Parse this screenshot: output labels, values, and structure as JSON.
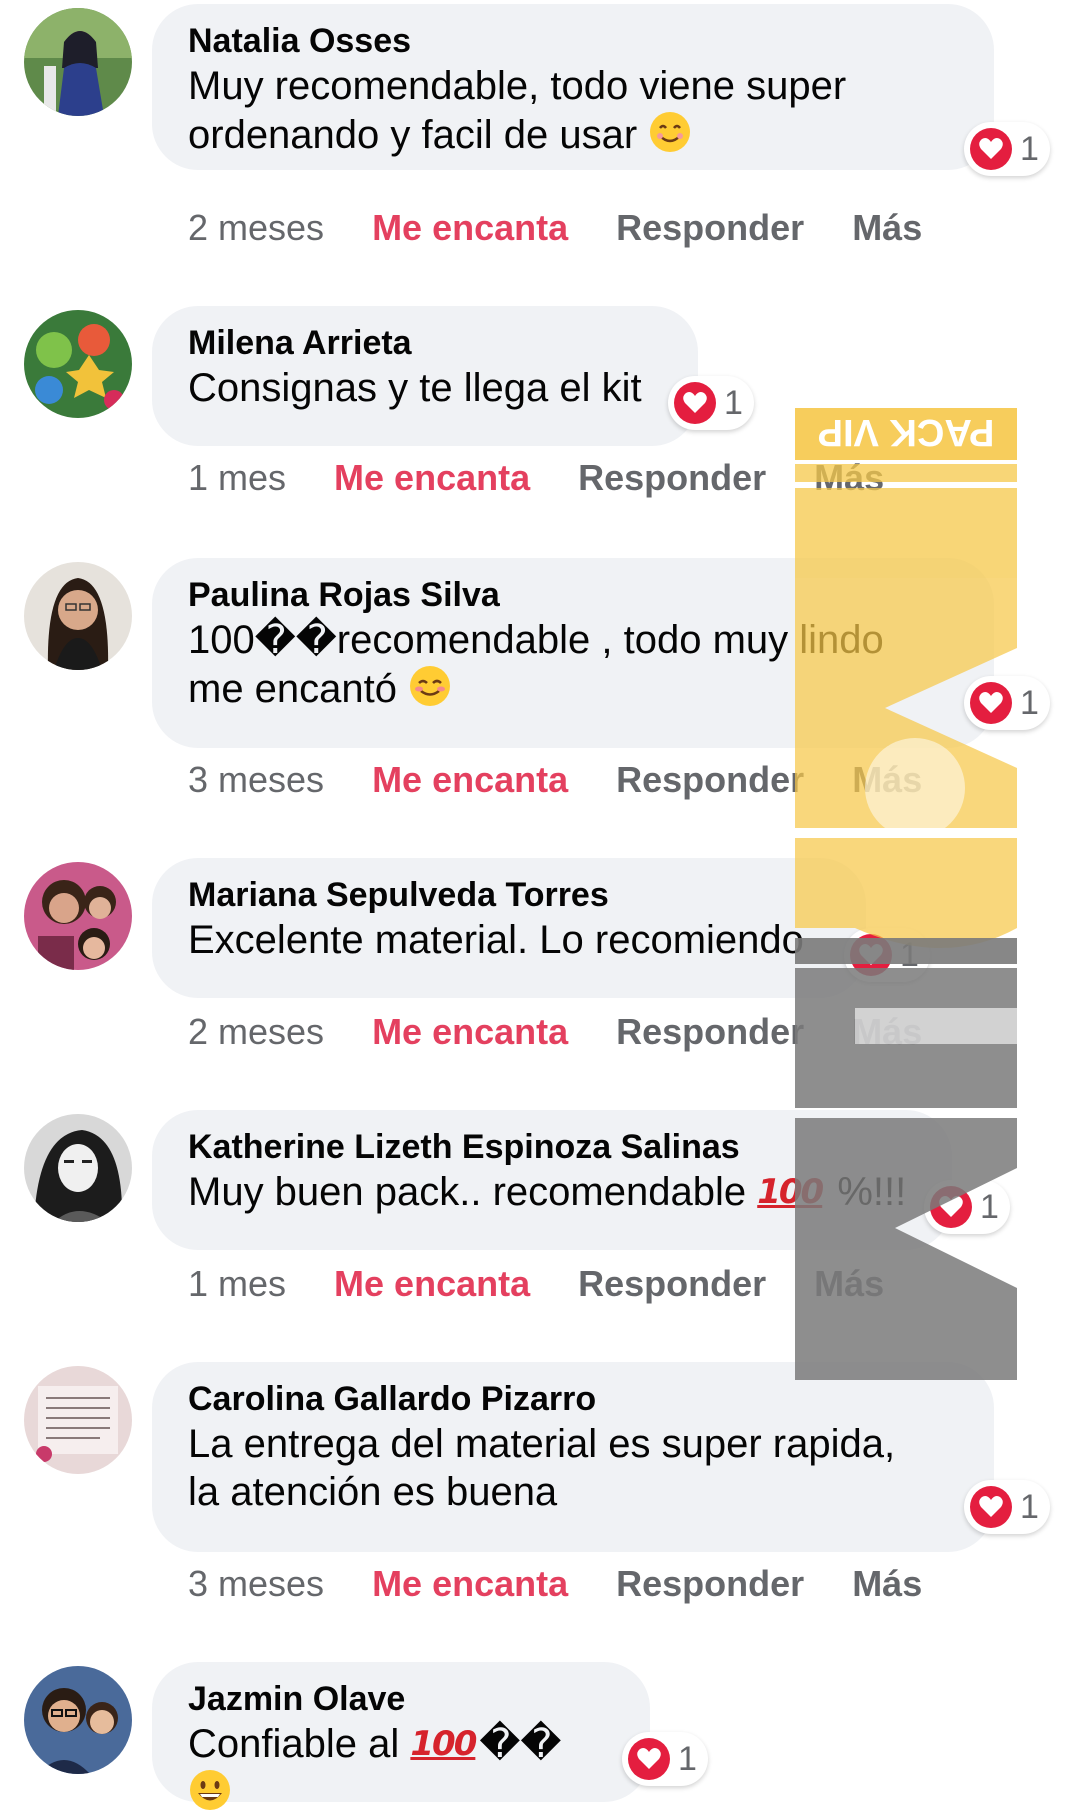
{
  "colors": {
    "bubble_bg": "#f0f2f5",
    "love_text": "#e4405f",
    "meta_text": "#65676b",
    "heart": "#e41e3f",
    "watermark_yellow": "#f6c84a",
    "watermark_gray": "#7a7a7a"
  },
  "watermark": {
    "label": "PACK VIP",
    "letters": "MEM"
  },
  "comments": [
    {
      "author": "Natalia Osses",
      "text": "Muy recomendable, todo viene super\nordenando y facil de usar",
      "emoji": "smiling-face-icon",
      "reaction_count": "1",
      "time": "2 meses",
      "love_label": "Me encanta",
      "reply_label": "Responder",
      "more_label": "Más"
    },
    {
      "author": "Milena Arrieta",
      "text": "Consignas y te llega el kit",
      "reaction_count": "1",
      "time": "1 mes",
      "love_label": "Me encanta",
      "reply_label": "Responder",
      "more_label": "Más"
    },
    {
      "author": "Paulina Rojas Silva",
      "text_part1": "100��recomendable , todo muy lindo",
      "text_part2": "me encantó",
      "emoji": "blushing-face-icon",
      "reaction_count": "1",
      "time": "3 meses",
      "love_label": "Me encanta",
      "reply_label": "Responder",
      "more_label": "Más"
    },
    {
      "author": "Mariana Sepulveda Torres",
      "text": "Excelente material. Lo recomiendo",
      "reaction_count": "1",
      "time": "2 meses",
      "love_label": "Me encanta",
      "reply_label": "Responder",
      "more_label": "Más"
    },
    {
      "author": "Katherine Lizeth Espinoza Salinas",
      "text_part1": "Muy buen pack.. recomendable",
      "hundred": "100",
      "text_part2": "%!!!",
      "reaction_count": "1",
      "time": "1 mes",
      "love_label": "Me encanta",
      "reply_label": "Responder",
      "more_label": "Más"
    },
    {
      "author": "Carolina Gallardo Pizarro",
      "text": "La entrega del material es super rapida,\nla atención es buena",
      "reaction_count": "1",
      "time": "3 meses",
      "love_label": "Me encanta",
      "reply_label": "Responder",
      "more_label": "Más"
    },
    {
      "author": "Jazmin Olave",
      "text_part1": "Confiable al",
      "hundred": "100",
      "text_part2": "��",
      "emoji": "grinning-face-icon",
      "reaction_count": "1"
    }
  ]
}
